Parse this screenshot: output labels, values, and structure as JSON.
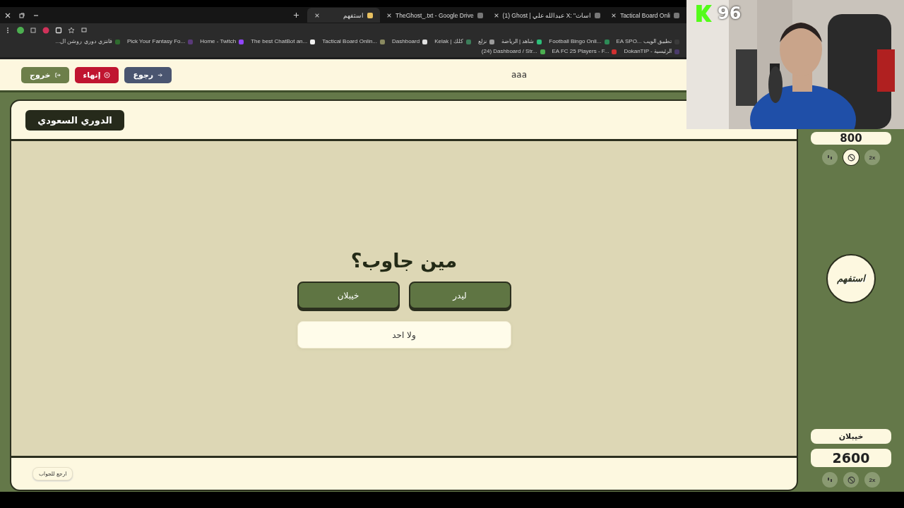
{
  "browser": {
    "tabs": [
      {
        "title": "Tactical Board Onli",
        "selected": false
      },
      {
        "title": "(1) Ghost | عبدالله علي X: \"اسات",
        "selected": false
      },
      {
        "title": "TheGhost_.txt - Google Drive",
        "selected": false
      },
      {
        "title": "استفهم",
        "selected": true
      }
    ],
    "bookmarks": [
      {
        "title": "EA SPO... تطبيق الويب",
        "color": "#3a3a3a"
      },
      {
        "title": "Football Bingo Onli...",
        "color": "#2e8b57"
      },
      {
        "title": "شاهد | الرياضة",
        "color": "#2dbf7a"
      },
      {
        "title": "نزلع",
        "color": "#9a9a9a"
      },
      {
        "title": "Kelak | كلك",
        "color": "#3c7d5a"
      },
      {
        "title": "Dashboard",
        "color": "#e0e0e0"
      },
      {
        "title": "Tactical Board Onlin...",
        "color": "#8a8a60"
      },
      {
        "title": "The best ChatBot an...",
        "color": "#f0f0f0"
      },
      {
        "title": "Home - Twitch",
        "color": "#9146ff"
      },
      {
        "title": "Pick Your Fantasy Fo...",
        "color": "#5a3a7a"
      },
      {
        "title": "فانتزي دوري روشن ال...",
        "color": "#2f6b2f"
      },
      {
        "title": "DokanTIP - الرئيسية",
        "color": "#4a3a6a"
      },
      {
        "title": "EA FC 25 Players - F...",
        "color": "#d03030"
      },
      {
        "title": "(24) Dashboard / Str...",
        "color": "#4caf50"
      }
    ]
  },
  "header": {
    "buttons": [
      {
        "label": "رجوع",
        "kind": "back"
      },
      {
        "label": "إنهاء",
        "kind": "end"
      },
      {
        "label": "خروج",
        "kind": "exit"
      }
    ],
    "title": "aaa"
  },
  "category": "الدوري السعودي",
  "question": "مين جاوب؟",
  "answers": [
    {
      "label": "ليدر",
      "kind": "team"
    },
    {
      "label": "خيبلان",
      "kind": "team"
    },
    {
      "label": "ولا احد",
      "kind": "none"
    }
  ],
  "back_to_answer": "ارجع للجواب",
  "teams": [
    {
      "score": "800",
      "powerups": [
        {
          "kind": "swap",
          "active": false
        },
        {
          "kind": "block",
          "active": true
        },
        {
          "kind": "double",
          "label": "2x",
          "active": false
        }
      ]
    },
    {
      "name": "خيبلان",
      "score": "2600",
      "powerups": [
        {
          "kind": "swap",
          "active": false
        },
        {
          "kind": "block",
          "active": false
        },
        {
          "kind": "double",
          "label": "2x",
          "active": false
        }
      ]
    }
  ],
  "logo": "استفهم",
  "stream_overlay": {
    "viewers": "96"
  }
}
